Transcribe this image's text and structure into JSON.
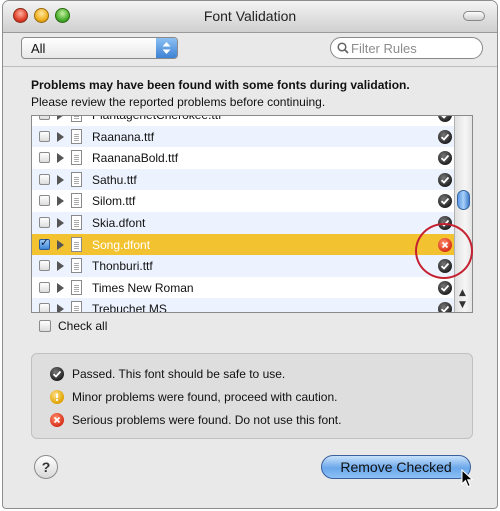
{
  "window": {
    "title": "Font Validation"
  },
  "toolbar": {
    "filter_popup_value": "All",
    "search_placeholder": "Filter Rules"
  },
  "message": {
    "headline": "Problems may have been found with some fonts during validation.",
    "detail": "Please review the reported problems before continuing."
  },
  "font_list": {
    "rows": [
      {
        "name": "PlantagenetCherokee.ttf",
        "checked": false,
        "status": "passed",
        "selected": false
      },
      {
        "name": "Raanana.ttf",
        "checked": false,
        "status": "passed",
        "selected": false
      },
      {
        "name": "RaananaBold.ttf",
        "checked": false,
        "status": "passed",
        "selected": false
      },
      {
        "name": "Sathu.ttf",
        "checked": false,
        "status": "passed",
        "selected": false
      },
      {
        "name": "Silom.ttf",
        "checked": false,
        "status": "passed",
        "selected": false
      },
      {
        "name": "Skia.dfont",
        "checked": false,
        "status": "passed",
        "selected": false
      },
      {
        "name": "Song.dfont",
        "checked": true,
        "status": "serious",
        "selected": true
      },
      {
        "name": "Thonburi.ttf",
        "checked": false,
        "status": "passed",
        "selected": false
      },
      {
        "name": "Times New Roman",
        "checked": false,
        "status": "passed",
        "selected": false
      },
      {
        "name": "Trebuchet MS",
        "checked": false,
        "status": "passed",
        "selected": false
      }
    ]
  },
  "check_all": {
    "label": "Check all"
  },
  "legend": {
    "passed": "Passed. This font should be safe to use.",
    "minor": "Minor problems were found, proceed with caution.",
    "serious": "Serious problems were found. Do not use this font."
  },
  "footer": {
    "help_label": "?",
    "remove_button": "Remove Checked"
  },
  "colors": {
    "selection": "#f2c230",
    "accent_blue": "#6aa7ea",
    "serious_red": "#d8301a",
    "minor_yellow": "#e0a200"
  }
}
